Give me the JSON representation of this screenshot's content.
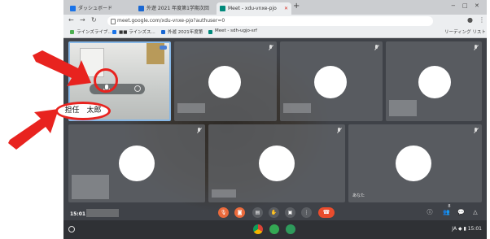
{
  "browser": {
    "tabs": [
      {
        "label": "ダッシュボード",
        "favicon_color": "#1a73e8"
      },
      {
        "label": "外遊 2021 年度第1学期次回",
        "favicon_color": "#1967d2"
      },
      {
        "label": "Meet - xdu-vnxe-pjo",
        "favicon_color": "#00897b"
      }
    ],
    "tab_close": "✕",
    "new_tab": "+",
    "window_controls": [
      "−",
      "□",
      "✕"
    ],
    "url": "meet.google.com/xdu-vnxe-pjo?authuser=0",
    "bookmarks": [
      {
        "label": "ラインズライブ...",
        "favicon_color": "#4caf50"
      },
      {
        "label": "■■ ラインズス...",
        "favicon_color": "#1a73e8"
      },
      {
        "label": "外遊 2021年度第",
        "favicon_color": "#1967d2"
      },
      {
        "label": "Meet - sdh-ugjo-srf",
        "favicon_color": "#00897b"
      }
    ],
    "reading_list": "リーディング リスト"
  },
  "meet": {
    "self_name_label": "担任　太郎",
    "tile_name_self": "あなた",
    "time": "15:01",
    "controls": [
      {
        "name": "mic-off-button",
        "glyph": "🎙",
        "style": "red"
      },
      {
        "name": "camera-off-button",
        "glyph": "◙",
        "style": "red"
      },
      {
        "name": "captions-button",
        "glyph": "▤",
        "style": "dark"
      },
      {
        "name": "raise-hand-button",
        "glyph": "✋",
        "style": "dark"
      },
      {
        "name": "present-button",
        "glyph": "▣",
        "style": "dark"
      },
      {
        "name": "more-options-button",
        "glyph": "⋮",
        "style": "dark"
      }
    ],
    "hangup_glyph": "☎",
    "right_icons": [
      "ⓘ",
      "👥",
      "💬",
      "△"
    ],
    "participant_count": "8"
  },
  "shelf": {
    "apps": [
      {
        "name": "chrome-app-icon",
        "color": "#e8b93a"
      },
      {
        "name": "play-store-app-icon",
        "color": "#34a853"
      },
      {
        "name": "meet-app-icon",
        "color": "#2e9a5b"
      }
    ],
    "tray_text": "JA ◆ ▮ 15:01"
  },
  "annotation_color": "#e8231f"
}
